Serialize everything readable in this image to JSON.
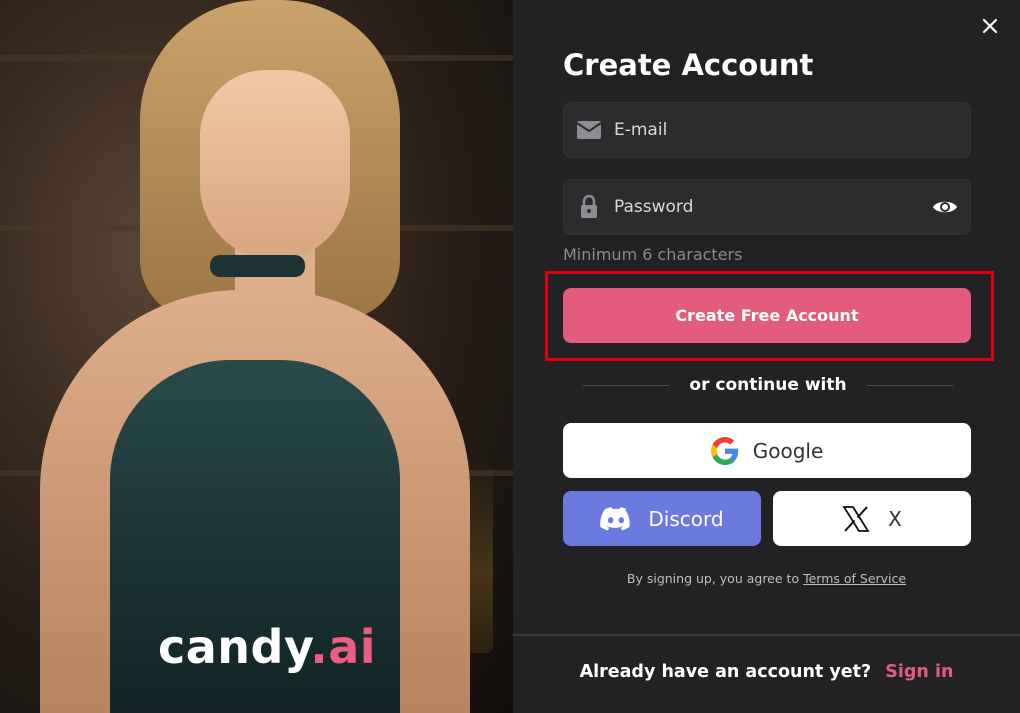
{
  "brand": {
    "name_main": "candy",
    "name_accent": ".ai"
  },
  "form": {
    "title": "Create Account",
    "email_placeholder": "E-mail",
    "password_placeholder": "Password",
    "password_hint": "Minimum 6 characters",
    "submit_label": "Create Free Account",
    "divider_text": "or continue with"
  },
  "social": {
    "google_label": "Google",
    "discord_label": "Discord",
    "x_label": "X"
  },
  "terms": {
    "prefix": "By signing up, you agree to",
    "link": "Terms of Service"
  },
  "footer": {
    "question": "Already have an account yet?",
    "signin": "Sign in"
  },
  "icons": {
    "close": "close-icon",
    "email": "mail-icon",
    "password": "lock-icon",
    "visibility": "eye-icon",
    "google": "google-icon",
    "discord": "discord-icon",
    "x": "x-icon"
  },
  "colors": {
    "accent": "#e35c7d",
    "discord": "#6c79de",
    "highlight": "#e1000b",
    "background": "#222224"
  }
}
